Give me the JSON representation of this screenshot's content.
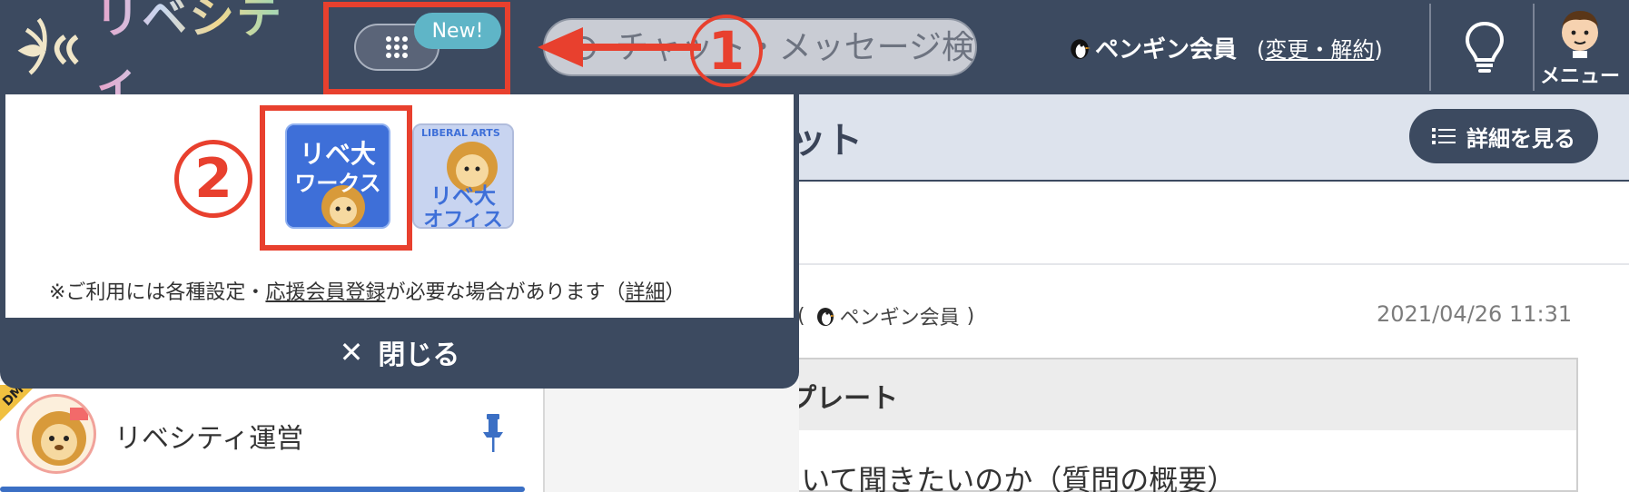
{
  "topbar": {
    "logo_text": "リベシティ",
    "new_badge": "New!",
    "search_placeholder": "チャット・メッセージ検",
    "step_one": "1",
    "member_name": "ペンギン会員",
    "change_prefix": "(",
    "change_link": "変更・解約",
    "change_suffix": ")",
    "menu_label": "メニュー"
  },
  "popup": {
    "step_two": "②",
    "apps": [
      {
        "name": "リベ大ワークス",
        "line1": "リベ大",
        "line2": "ワークス"
      },
      {
        "name": "リベ大オフィス",
        "line1": "リベ大",
        "line2": "オフィス",
        "arc": "LIBERAL ARTS"
      }
    ],
    "note_prefix": "※ご利用には各種設定・",
    "note_link": "応援会員登録",
    "note_middle": "が必要な場合があります（",
    "note_detail_link": "詳細",
    "note_suffix": "）",
    "close_label": "閉じる"
  },
  "main": {
    "header_title_fragment": "ット",
    "detail_button": "詳細を見る",
    "post_author_prefix": "(",
    "post_author": "ペンギン会員",
    "post_author_suffix": ")",
    "post_time": "2021/04/26 11:31",
    "template_title": "質問テンプレート",
    "template_line": "■何について聞きたいのか（質問の概要）"
  },
  "sidebar": {
    "dm_badge": "DM",
    "room_name": "リベシティ運営"
  },
  "colors": {
    "topbar": "#3c4a60",
    "annotation_red": "#e8402e",
    "new_badge": "#5fb5c7",
    "accent_blue": "#3b6fc4"
  }
}
